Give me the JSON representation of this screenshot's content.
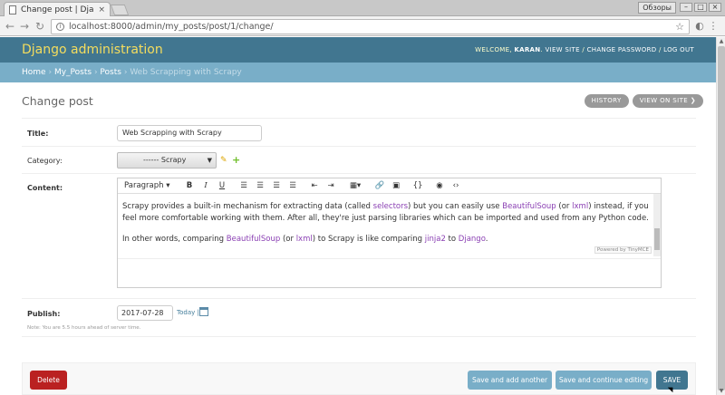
{
  "browser": {
    "tab_title": "Change post | Django s",
    "tab_close": "×",
    "user_chip": "Обзоры",
    "url": "localhost:8000/admin/my_posts/post/1/change/"
  },
  "header": {
    "branding": "Django administration",
    "welcome": "WELCOME,",
    "username": "KARAN",
    "view_site": "VIEW SITE",
    "change_password": "CHANGE PASSWORD",
    "log_out": "LOG OUT"
  },
  "breadcrumbs": {
    "home": "Home",
    "app": "My_Posts",
    "model": "Posts",
    "current": "Web Scrapping with Scrapy",
    "sep": "›"
  },
  "page": {
    "title": "Change post",
    "history": "HISTORY",
    "view_on_site": "VIEW ON SITE"
  },
  "form": {
    "title_label": "Title:",
    "title_value": "Web Scrapping with Scrapy",
    "category_label": "Category:",
    "category_value": "------ Scrapy",
    "content_label": "Content:",
    "publish_label": "Publish:",
    "publish_value": "2017-07-28",
    "today": "Today",
    "note": "Note: You are 5.5 hours ahead of server time."
  },
  "editor": {
    "format": "Paragraph",
    "p1_a": "Scrapy provides a built-in mechanism for extracting data (called ",
    "p1_link1": "selectors",
    "p1_b": ") but you can easily use ",
    "p1_link2": "BeautifulSoup",
    "p1_c": " (or ",
    "p1_link3": "lxml",
    "p1_d": ") instead, if you feel more comfortable working with them. After all, they're just parsing libraries which can be imported and used from any Python code.",
    "p2_a": "In other words, comparing ",
    "p2_link1": "BeautifulSoup",
    "p2_b": " (or ",
    "p2_link2": "lxml",
    "p2_c": ") to Scrapy is like comparing ",
    "p2_link3": "jinja2",
    "p2_d": " to ",
    "p2_link4": "Django",
    "p2_e": ".",
    "powered_by": "Powered by TinyMCE"
  },
  "buttons": {
    "delete": "Delete",
    "save_add_another": "Save and add another",
    "save_continue": "Save and continue editing",
    "save": "SAVE"
  }
}
